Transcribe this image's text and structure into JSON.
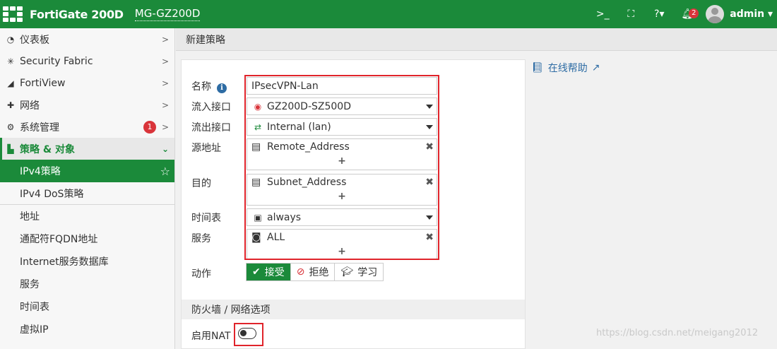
{
  "header": {
    "product": "FortiGate 200D",
    "hostname": "MG-GZ200D",
    "cli_icon": ">_",
    "fullscreen_icon": "⛶",
    "help_icon": "?▾",
    "notification_count": "2",
    "user": "admin"
  },
  "sidebar": {
    "items": [
      {
        "label": "仪表板",
        "icon": "dashboard-icon"
      },
      {
        "label": "Security Fabric",
        "icon": "security-fabric-icon"
      },
      {
        "label": "FortiView",
        "icon": "chart-icon"
      },
      {
        "label": "网络",
        "icon": "network-icon"
      },
      {
        "label": "系统管理",
        "icon": "gear-icon",
        "badge": "1"
      },
      {
        "label": "策略 & 对象",
        "icon": "policy-icon"
      }
    ],
    "subitems": [
      "IPv4策略",
      "IPv4 DoS策略",
      "地址",
      "通配符FQDN地址",
      "Internet服务数据库",
      "服务",
      "时间表",
      "虚拟IP"
    ]
  },
  "breadcrumb": "新建策略",
  "help_link": "在线帮助",
  "form": {
    "name_label": "名称",
    "name_value": "IPsecVPN-Lan",
    "in_iface_label": "流入接口",
    "in_iface_value": "GZ200D-SZ500D",
    "out_iface_label": "流出接口",
    "out_iface_value": "Internal (lan)",
    "src_label": "源地址",
    "src_value": "Remote_Address",
    "dst_label": "目的",
    "dst_value": "Subnet_Address",
    "schedule_label": "时间表",
    "schedule_value": "always",
    "service_label": "服务",
    "service_value": "ALL",
    "action_label": "动作",
    "actions": [
      "接受",
      "拒绝",
      "学习"
    ],
    "section_title": "防火墙 / 网络选项",
    "nat_label": "启用NAT"
  },
  "watermark": "https://blog.csdn.net/meigang2012",
  "colors": {
    "brand": "#1b8a3a",
    "highlight": "#e0242b",
    "link": "#2e6ca4"
  }
}
